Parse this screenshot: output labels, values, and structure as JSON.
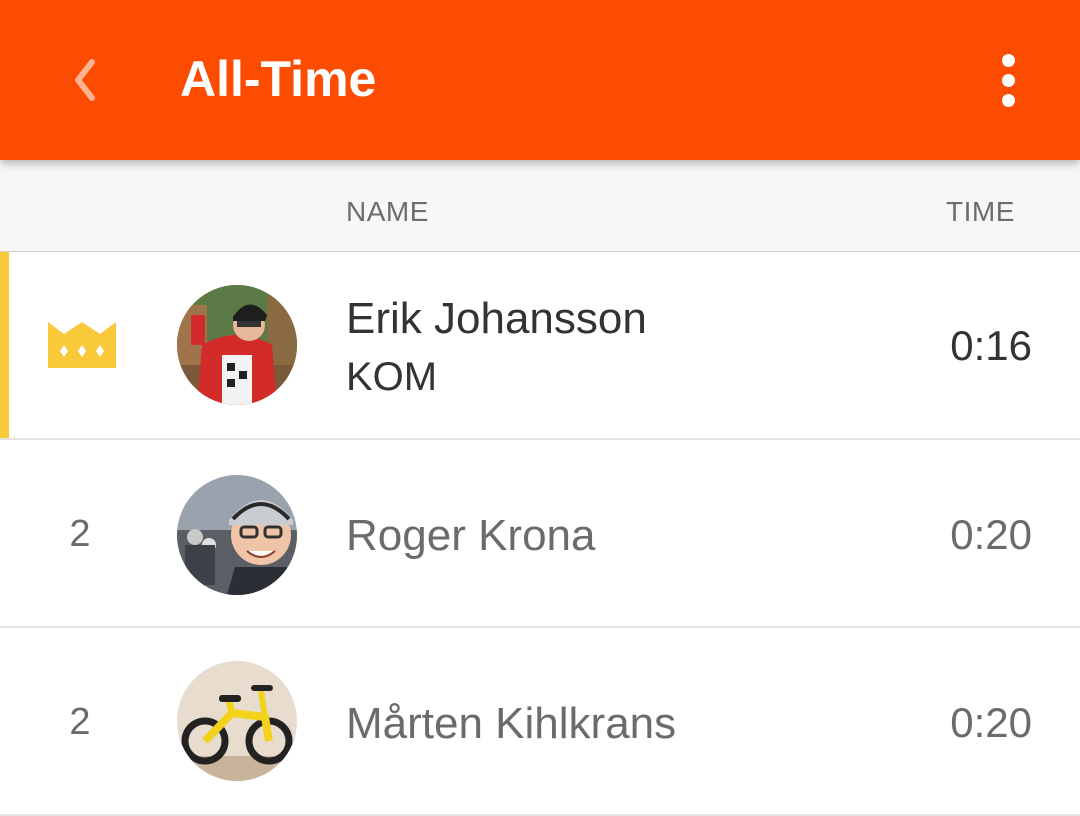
{
  "appbar": {
    "title": "All-Time",
    "back_icon": "chevron-left-icon",
    "menu_icon": "more-vertical-icon",
    "color": "#fc4c02"
  },
  "columns": {
    "name": "NAME",
    "time": "TIME"
  },
  "leaderboard": [
    {
      "rank": "",
      "rank_icon": "crown-icon",
      "name": "Erik Johansson",
      "badge": "KOM",
      "time": "0:16",
      "highlight_color": "#f9c93a"
    },
    {
      "rank": "2",
      "name": "Roger Krona",
      "time": "0:20"
    },
    {
      "rank": "2",
      "name": "Mårten Kihlkrans",
      "time": "0:20"
    }
  ]
}
